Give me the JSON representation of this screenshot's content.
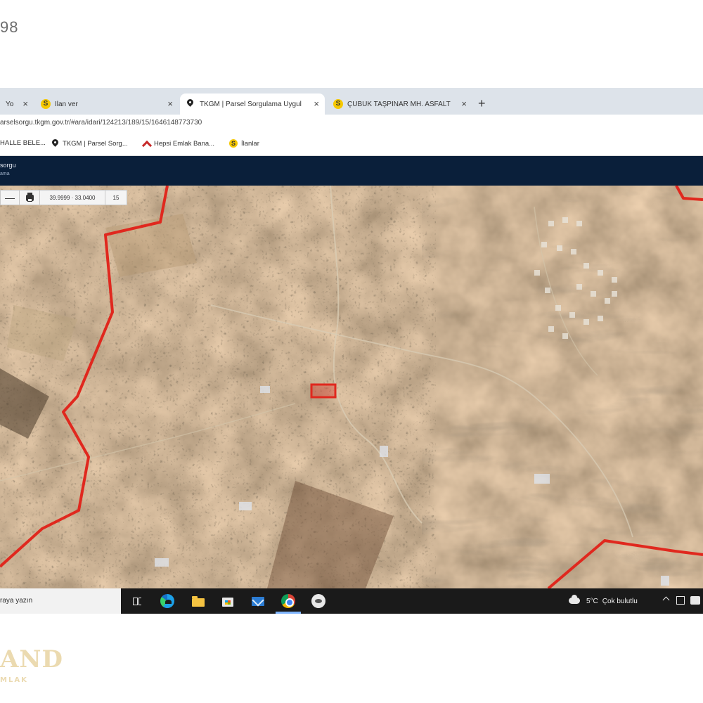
{
  "page": {
    "number": "98"
  },
  "browser": {
    "tabs": [
      {
        "label": "Yo",
        "favicon": "page-icon",
        "active": false
      },
      {
        "label": "İlan ver",
        "favicon": "sahibinden-s-icon",
        "active": false
      },
      {
        "label": "TKGM | Parsel Sorgulama Uygul",
        "favicon": "map-pin-icon",
        "active": true
      },
      {
        "label": "ÇUBUK TAŞPINAR MH. ASFALT",
        "favicon": "sahibinden-s-icon",
        "active": false
      }
    ],
    "new_tab_glyph": "+",
    "close_glyph": "×",
    "url": "arselsorgu.tkgm.gov.tr/#ara/idari/124213/189/15/1646148773730",
    "bookmarks": [
      {
        "label": "HALLE BELE...",
        "favicon": "none"
      },
      {
        "label": "TKGM | Parsel Sorg...",
        "favicon": "map-pin-icon"
      },
      {
        "label": "Hepsi Emlak Bana...",
        "favicon": "hepsiemlak-icon"
      },
      {
        "label": "İlanlar",
        "favicon": "sahibinden-s-icon"
      }
    ]
  },
  "app": {
    "title": "sorgu",
    "subtitle": "ama",
    "header_color": "#0a1f3a"
  },
  "map": {
    "toolbar": {
      "zoom_out": "—",
      "print_icon": "print-icon",
      "coordinates": "39.9999 · 33.0400",
      "zoom_level": "15"
    },
    "boundary_color": "#e0281e",
    "parcel_color": "#e0281e"
  },
  "taskbar": {
    "search_text": "raya yazın",
    "apps": [
      "task-view-icon",
      "edge-icon",
      "file-explorer-icon",
      "store-icon",
      "mail-icon",
      "chrome-icon",
      "app-icon"
    ],
    "weather_temp": "5°C",
    "weather_desc": "Çok bulutlu"
  },
  "watermark": {
    "main": "AND",
    "sub": "MLAK"
  }
}
